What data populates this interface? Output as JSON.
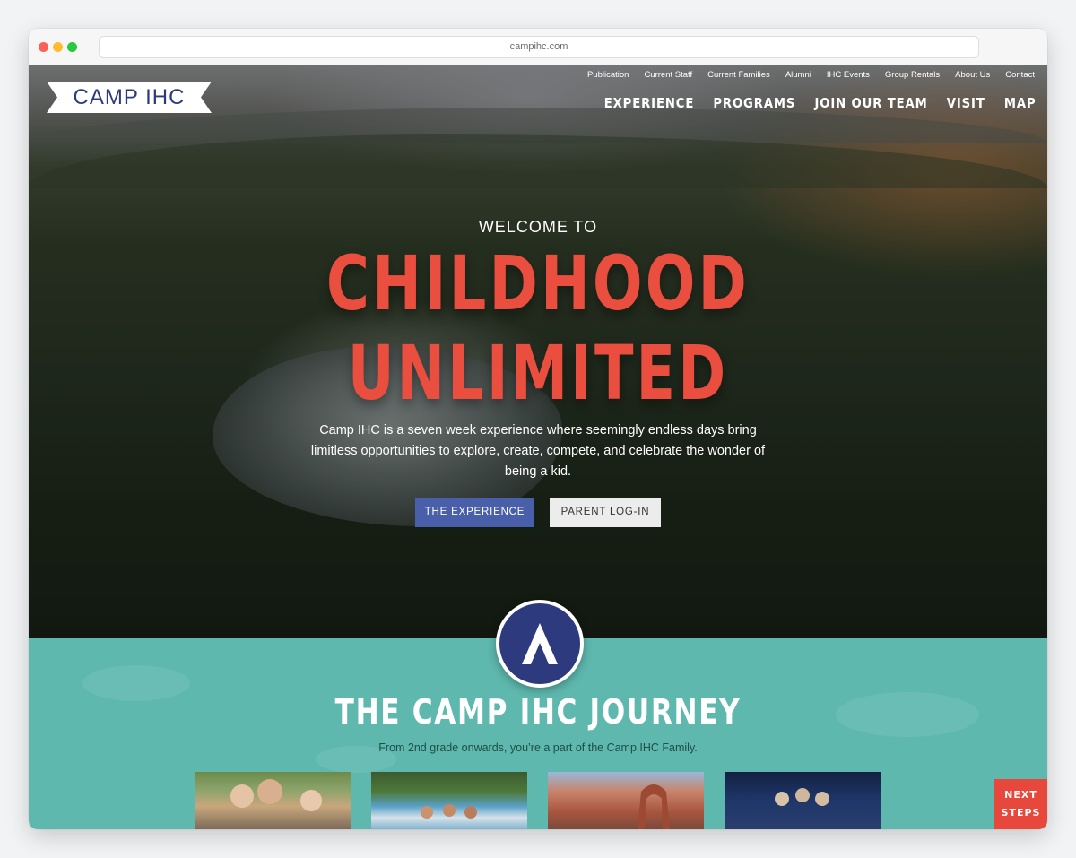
{
  "browser": {
    "url": "campihc.com"
  },
  "utility_nav": [
    "Publication",
    "Current Staff",
    "Current Families",
    "Alumni",
    "IHC Events",
    "Group Rentals",
    "About Us",
    "Contact"
  ],
  "logo": {
    "text": "CAMP IHC"
  },
  "main_nav": [
    "EXPERIENCE",
    "PROGRAMS",
    "JOIN OUR TEAM",
    "VISIT",
    "MAP"
  ],
  "hero": {
    "welcome": "WELCOME TO",
    "headline_line1": "CHILDHOOD",
    "headline_line2": "UNLIMITED",
    "intro": "Camp IHC is a seven week experience where seemingly endless days bring limitless opportunities to explore, create, compete, and celebrate the wonder of being a kid.",
    "primary_button": "THE EXPERIENCE",
    "secondary_button": "PARENT LOG-IN"
  },
  "journey": {
    "title": "THE CAMP IHC JOURNEY",
    "subtitle": "From 2nd grade onwards, you’re a part of the Camp IHC Family."
  },
  "next_steps": {
    "line1": "NEXT",
    "line2": "STEPS"
  },
  "colors": {
    "accent_red": "#ea4e3f",
    "navy": "#2e3a7e",
    "teal": "#5eb8ae",
    "button_blue": "#4a5faa"
  }
}
